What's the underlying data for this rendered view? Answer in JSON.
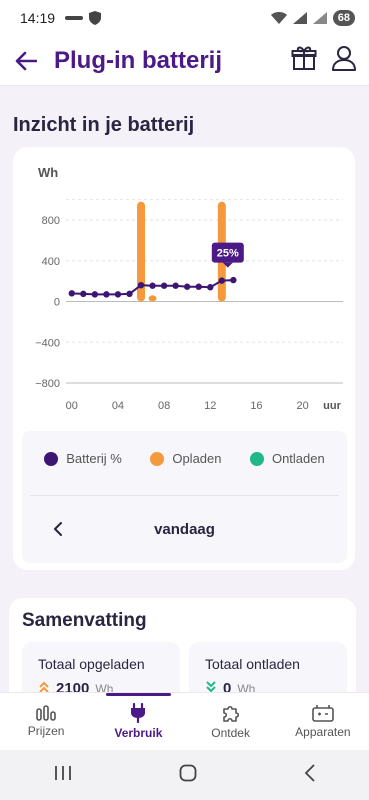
{
  "status_bar": {
    "time": "14:19",
    "battery": "68"
  },
  "app_bar": {
    "title": "Plug-in batterij"
  },
  "section": {
    "title": "Inzicht in je batterij"
  },
  "chart_data": {
    "type": "bar",
    "ylabel": "Wh",
    "xlabel": "uur",
    "ylim": [
      -800,
      1000
    ],
    "y_ticks": [
      "800",
      "400",
      "0",
      "−400",
      "−800"
    ],
    "y_tick_values": [
      800,
      400,
      0,
      -400,
      -800
    ],
    "x_ticks": [
      "00",
      "04",
      "08",
      "12",
      "16",
      "20"
    ],
    "x_tick_values": [
      0,
      4,
      8,
      12,
      16,
      20
    ],
    "xlim": [
      -0.5,
      23.5
    ],
    "colors": {
      "battery": "#3d1673",
      "charge": "#f59a3c",
      "discharge": "#1fb886"
    },
    "series": [
      {
        "name": "Opladen",
        "type": "bar",
        "x": [
          6,
          7,
          13
        ],
        "values": [
          980,
          60,
          980
        ]
      },
      {
        "name": "Batterij %",
        "type": "line",
        "x": [
          0,
          1,
          2,
          3,
          4,
          5,
          6,
          7,
          8,
          9,
          10,
          11,
          12,
          13,
          14
        ],
        "values": [
          80,
          75,
          70,
          70,
          70,
          75,
          160,
          155,
          155,
          155,
          145,
          145,
          140,
          205,
          210
        ]
      }
    ],
    "tooltip": {
      "x": 13,
      "value": 205,
      "label": "25%"
    }
  },
  "legend": [
    {
      "label": "Batterij %",
      "color": "#3d1673"
    },
    {
      "label": "Opladen",
      "color": "#f59a3c"
    },
    {
      "label": "Ontladen",
      "color": "#1fb886"
    }
  ],
  "day_nav": {
    "label": "vandaag"
  },
  "summary": {
    "title": "Samenvatting",
    "charged": {
      "label": "Totaal opgeladen",
      "value": "2100",
      "unit": "Wh"
    },
    "discharged": {
      "label": "Totaal ontladen",
      "value": "0",
      "unit": "Wh"
    }
  },
  "bottom_nav": [
    {
      "label": "Prijzen",
      "icon": "chart-bars-icon"
    },
    {
      "label": "Verbruik",
      "icon": "plug-icon",
      "active": true
    },
    {
      "label": "Ontdek",
      "icon": "puzzle-icon"
    },
    {
      "label": "Apparaten",
      "icon": "battery-device-icon"
    }
  ]
}
